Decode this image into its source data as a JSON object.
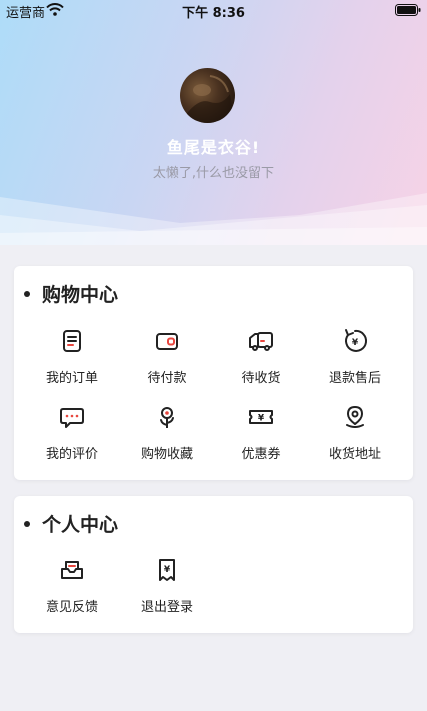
{
  "status_bar": {
    "carrier": "运营商",
    "time": "下午 8:36"
  },
  "profile": {
    "username": "鱼尾是衣谷!",
    "bio": "太懒了,什么也没留下"
  },
  "shopping_center": {
    "title": "购物中心",
    "items": [
      {
        "label": "我的订单",
        "icon": "order-list-icon"
      },
      {
        "label": "待付款",
        "icon": "wallet-icon"
      },
      {
        "label": "待收货",
        "icon": "delivery-truck-icon"
      },
      {
        "label": "退款售后",
        "icon": "refund-icon"
      },
      {
        "label": "我的评价",
        "icon": "comment-icon"
      },
      {
        "label": "购物收藏",
        "icon": "flower-favorite-icon"
      },
      {
        "label": "优惠券",
        "icon": "coupon-icon"
      },
      {
        "label": "收货地址",
        "icon": "location-pin-icon"
      }
    ]
  },
  "personal_center": {
    "title": "个人中心",
    "items": [
      {
        "label": "意见反馈",
        "icon": "feedback-inbox-icon"
      },
      {
        "label": "退出登录",
        "icon": "logout-receipt-icon"
      }
    ]
  },
  "colors": {
    "hero_gradient": [
      "#aedcf8",
      "#f7d3e6"
    ],
    "page_background": "#efeff4",
    "card_background": "#ffffff",
    "accent_icon": "#e8473f"
  }
}
